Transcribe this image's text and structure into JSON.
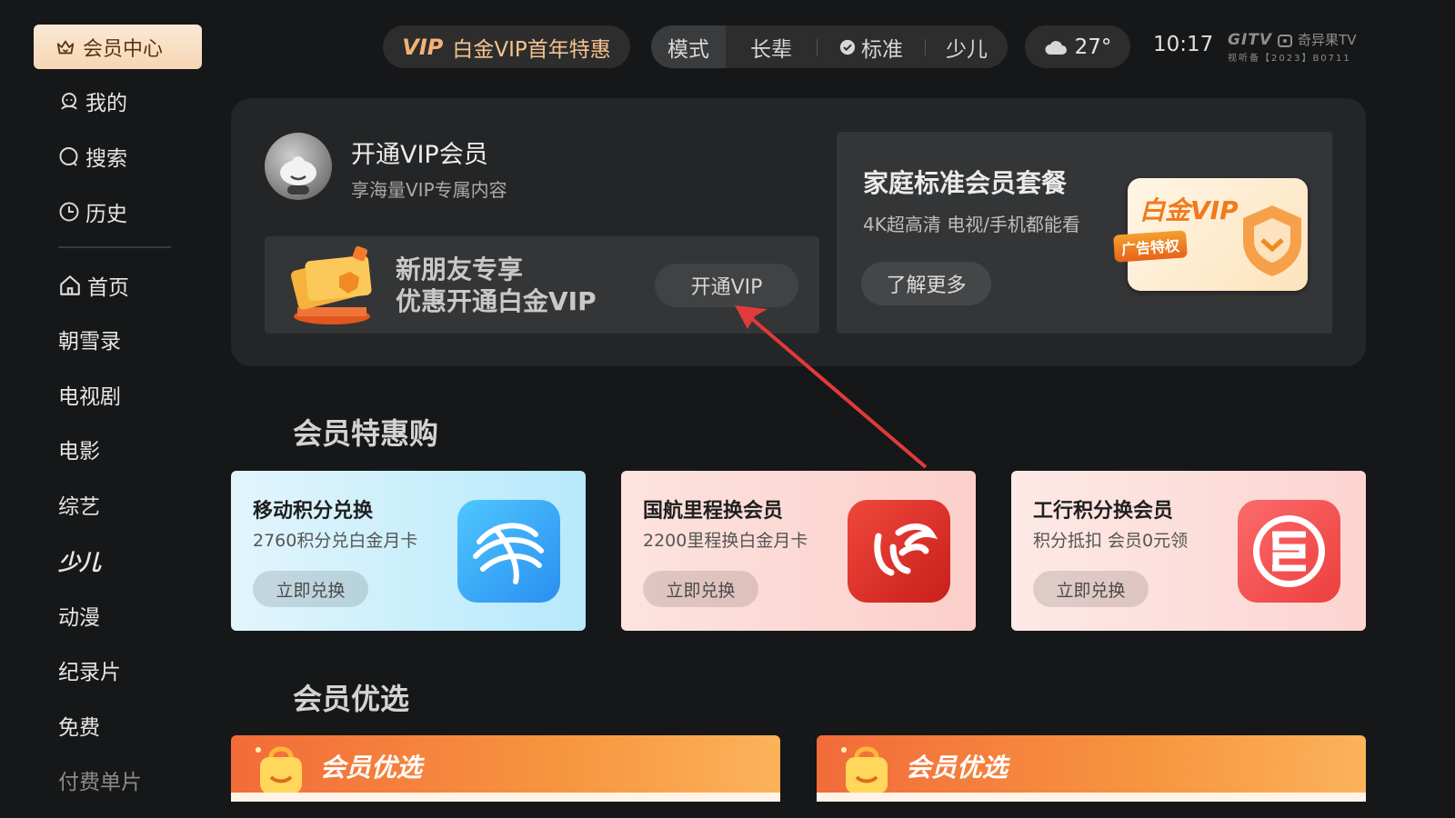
{
  "sidebar": {
    "active": "会员中心",
    "user_items": [
      "我的",
      "搜索",
      "历史"
    ],
    "nav_items": [
      "首页",
      "朝雪录",
      "电视剧",
      "电影",
      "综艺",
      "少儿",
      "动漫",
      "纪录片",
      "免费",
      "付费单片"
    ]
  },
  "topbar": {
    "vip_promo_badge": "VIP",
    "vip_promo_text": "白金VIP首年特惠",
    "modes": [
      "模式",
      "长辈",
      "标准",
      "少儿"
    ],
    "temperature": "27°",
    "time": "10:17",
    "brand_logo": "GITV",
    "brand_name": "奇异果TV",
    "license": "视听备【2023】B0711"
  },
  "vip_panel": {
    "title": "开通VIP会员",
    "subtitle": "享海量VIP专属内容",
    "promo_line1": "新朋友专享",
    "promo_line2": "优惠开通白金VIP",
    "open_button": "开通VIP",
    "family_title": "家庭标准会员套餐",
    "family_subtitle": "4K超高清 电视/手机都能看",
    "learn_more": "了解更多",
    "card_label": "白金VIP",
    "card_tag": "广告特权"
  },
  "deals_section": {
    "title": "会员特惠购",
    "cards": [
      {
        "title": "移动积分兑换",
        "subtitle": "2760积分兑白金月卡",
        "button": "立即兑换",
        "logo": "china-mobile-logo"
      },
      {
        "title": "国航里程换会员",
        "subtitle": "2200里程换白金月卡",
        "button": "立即兑换",
        "logo": "air-china-logo"
      },
      {
        "title": "工行积分换会员",
        "subtitle": "积分抵扣 会员0元领",
        "button": "立即兑换",
        "logo": "icbc-logo"
      }
    ]
  },
  "picks_section": {
    "title": "会员优选",
    "banners": [
      "会员优选",
      "会员优选"
    ]
  },
  "colors": {
    "background": "#161718",
    "panel": "#242526",
    "active_nav": "#f6d6b4",
    "accent_gold": "#f2b376",
    "annotation_arrow": "#e03a3a"
  }
}
